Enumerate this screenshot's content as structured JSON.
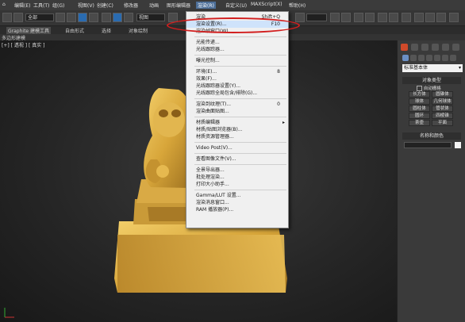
{
  "menubar": {
    "items": [
      "编辑(E)",
      "工具(T)",
      "组(G)",
      "视图(V)",
      "创建(C)",
      "修改器",
      "动画",
      "图形编辑器",
      "渲染(R)",
      "自定义(U)",
      "MAXScript(X)",
      "帮助(H)"
    ]
  },
  "toolbar": {
    "filter_value": "全部",
    "view_value": "视图"
  },
  "ribbon": {
    "tabs": [
      "Graphite 建模工具",
      "自由形式",
      "选择",
      "对象绘制"
    ],
    "sub_label": "多边形建模"
  },
  "viewport": {
    "label": "[+] [ 透视 ] [ 真实 ]"
  },
  "right_panel": {
    "dropdown_value": "标准基本体",
    "object_type_header": "对象类型",
    "autogrid_label": "自动栅格",
    "buttons": [
      "长方体",
      "圆锥体",
      "球体",
      "几何球体",
      "圆柱体",
      "管状体",
      "圆环",
      "四棱锥",
      "茶壶",
      "平面"
    ],
    "name_color_header": "名称和颜色"
  },
  "render_menu": {
    "items": [
      {
        "label": "渲染",
        "shortcut": "Shift+Q"
      },
      {
        "label": "渲染设置(R)...",
        "shortcut": "F10"
      },
      {
        "label": "渲染帧窗口(W)...",
        "shortcut": ""
      },
      {
        "sep": true
      },
      {
        "label": "光能传递...",
        "shortcut": ""
      },
      {
        "label": "光线跟踪器...",
        "shortcut": ""
      },
      {
        "sep": true
      },
      {
        "label": "曝光控制...",
        "shortcut": ""
      },
      {
        "sep": true
      },
      {
        "label": "环境(E)...",
        "shortcut": "8"
      },
      {
        "label": "效果(F)...",
        "shortcut": ""
      },
      {
        "label": "光线跟踪器设置(Y)...",
        "shortcut": ""
      },
      {
        "label": "光线跟踪全局包含/排除(G)...",
        "shortcut": ""
      },
      {
        "sep": true
      },
      {
        "label": "渲染到纹理(T)...",
        "shortcut": "0"
      },
      {
        "label": "渲染曲面贴图...",
        "shortcut": ""
      },
      {
        "sep": true
      },
      {
        "label": "材质编辑器",
        "shortcut": "",
        "submenu": true
      },
      {
        "label": "材质/贴图浏览器(B)...",
        "shortcut": ""
      },
      {
        "label": "材质资源管理器...",
        "shortcut": ""
      },
      {
        "sep": true
      },
      {
        "label": "Video Post(V)...",
        "shortcut": ""
      },
      {
        "sep": true
      },
      {
        "label": "查看图像文件(V)...",
        "shortcut": ""
      },
      {
        "sep": true
      },
      {
        "label": "全景导出器...",
        "shortcut": ""
      },
      {
        "label": "批处理渲染...",
        "shortcut": ""
      },
      {
        "label": "打印大小助手...",
        "shortcut": ""
      },
      {
        "sep": true
      },
      {
        "label": "Gamma/LUT 设置...",
        "shortcut": ""
      },
      {
        "label": "渲染消息窗口...",
        "shortcut": ""
      },
      {
        "label": "RAM 播放器(P)...",
        "shortcut": ""
      }
    ],
    "highlighted_index": 1
  },
  "colors": {
    "highlight_circle": "#d21e1e",
    "statue_gold": "#d8a63a"
  }
}
